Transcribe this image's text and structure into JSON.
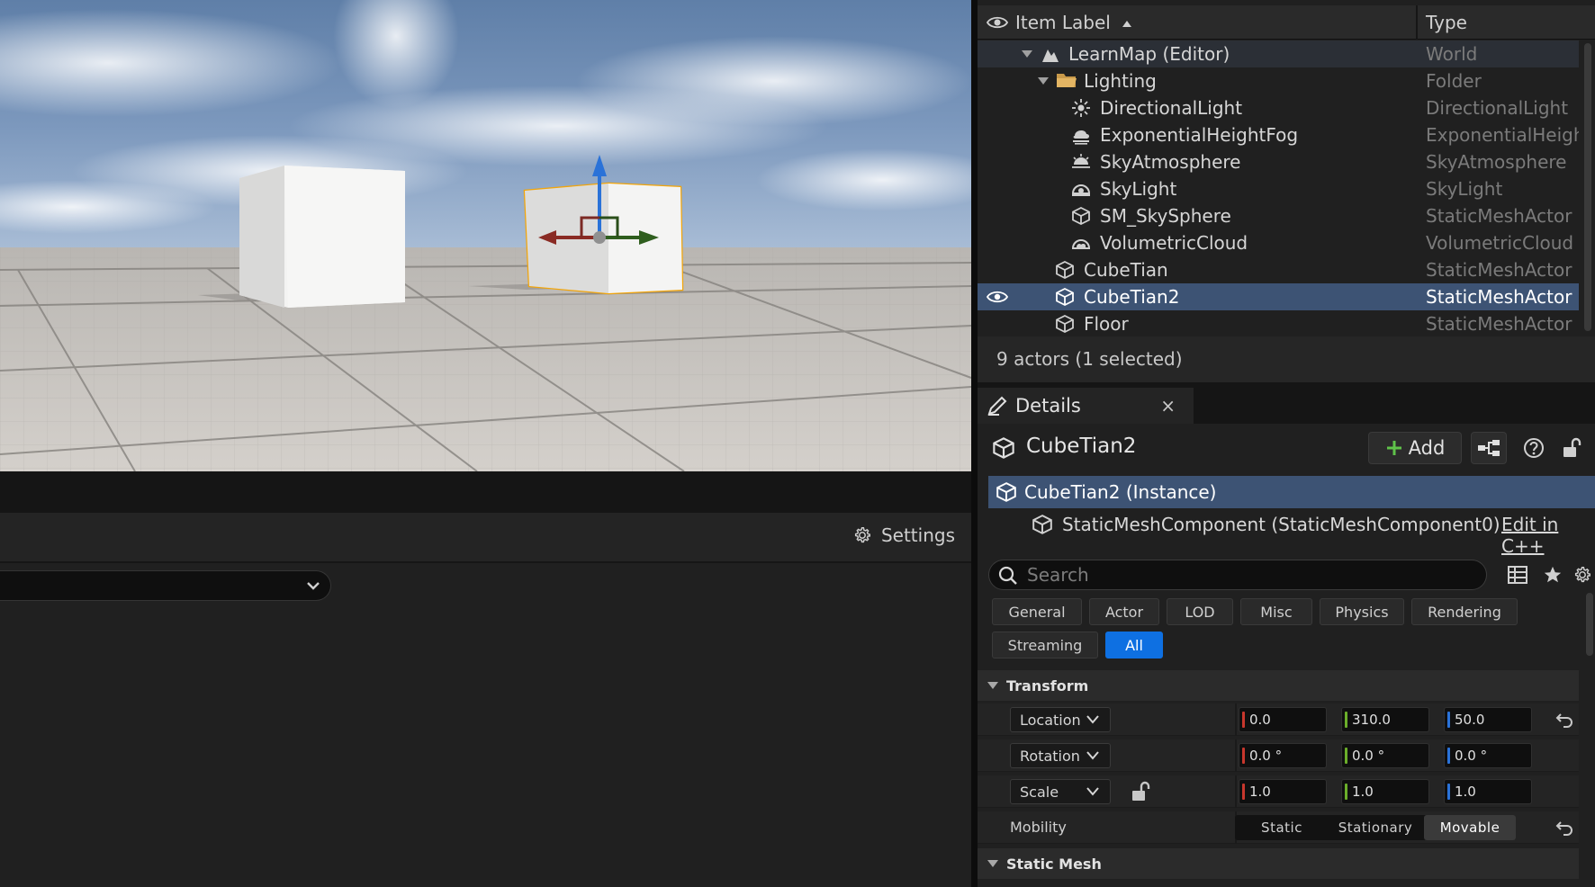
{
  "lower_left": {
    "settings_label": "Settings"
  },
  "outliner": {
    "col_label": "Item Label",
    "col_type": "Type",
    "rows": [
      {
        "label": "LearnMap (Editor)",
        "type": "World"
      },
      {
        "label": "Lighting",
        "type": "Folder"
      },
      {
        "label": "DirectionalLight",
        "type": "DirectionalLight"
      },
      {
        "label": "ExponentialHeightFog",
        "type": "ExponentialHeightF"
      },
      {
        "label": "SkyAtmosphere",
        "type": "SkyAtmosphere"
      },
      {
        "label": "SkyLight",
        "type": "SkyLight"
      },
      {
        "label": "SM_SkySphere",
        "type": "StaticMeshActor"
      },
      {
        "label": "VolumetricCloud",
        "type": "VolumetricCloud"
      },
      {
        "label": "CubeTian",
        "type": "StaticMeshActor"
      },
      {
        "label": "CubeTian2",
        "type": "StaticMeshActor"
      },
      {
        "label": "Floor",
        "type": "StaticMeshActor"
      }
    ],
    "footer": "9 actors (1 selected)"
  },
  "details": {
    "tab_title": "Details",
    "tab_close": "×",
    "actor_name": "CubeTian2",
    "add_label": "Add",
    "instance_label": "CubeTian2 (Instance)",
    "component_label": "StaticMeshComponent (StaticMeshComponent0)",
    "edit_cpp": "Edit in C++",
    "search_placeholder": "Search",
    "filters": [
      "General",
      "Actor",
      "LOD",
      "Misc",
      "Physics",
      "Rendering",
      "Streaming",
      "All"
    ],
    "active_filter": "All",
    "transform": {
      "title": "Transform",
      "location_label": "Location",
      "location": [
        "0.0",
        "310.0",
        "50.0"
      ],
      "rotation_label": "Rotation",
      "rotation": [
        "0.0 °",
        "0.0 °",
        "0.0 °"
      ],
      "scale_label": "Scale",
      "scale": [
        "1.0",
        "1.0",
        "1.0"
      ],
      "mobility_label": "Mobility",
      "mobility_options": [
        "Static",
        "Stationary",
        "Movable"
      ],
      "mobility_selected": "Movable"
    },
    "static_mesh_title": "Static Mesh"
  },
  "colors": {
    "selection": "#3d5374",
    "accent_blue": "#0e70e2",
    "axis_x": "#c8372d",
    "axis_y": "#6bae2a",
    "axis_z": "#2a72d8",
    "selection_outline": "#f2a50a"
  }
}
